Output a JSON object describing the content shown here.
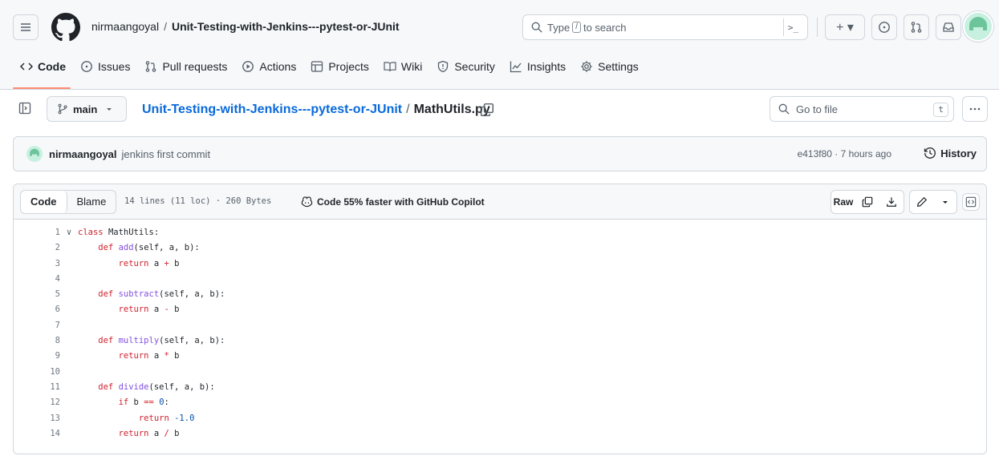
{
  "header": {
    "owner": "nirmaangoyal",
    "separator": "/",
    "repo": "Unit-Testing-with-Jenkins---pytest-or-JUnit",
    "search_prefix": "Type",
    "search_key": "/",
    "search_suffix": "to search",
    "terminal_label": ">_",
    "plus_label": "+ ▾"
  },
  "tabs": [
    {
      "label": "Code",
      "icon": "code-icon"
    },
    {
      "label": "Issues",
      "icon": "issue-icon"
    },
    {
      "label": "Pull requests",
      "icon": "pull-request-icon"
    },
    {
      "label": "Actions",
      "icon": "play-icon"
    },
    {
      "label": "Projects",
      "icon": "table-icon"
    },
    {
      "label": "Wiki",
      "icon": "book-icon"
    },
    {
      "label": "Security",
      "icon": "shield-icon"
    },
    {
      "label": "Insights",
      "icon": "graph-icon"
    },
    {
      "label": "Settings",
      "icon": "gear-icon"
    }
  ],
  "breadcrumb": {
    "branch": "main",
    "repo": "Unit-Testing-with-Jenkins---pytest-or-JUnit",
    "sep": "/",
    "file": "MathUtils.py",
    "goto_placeholder": "Go to file",
    "goto_key": "t"
  },
  "commit": {
    "user": "nirmaangoyal",
    "message": "jenkins first commit",
    "meta": "e413f80 · 7 hours ago",
    "history_label": "History"
  },
  "file": {
    "code_tab": "Code",
    "blame_tab": "Blame",
    "info": "14 lines (11 loc) · 260 Bytes",
    "copilot": "Code 55% faster with GitHub Copilot",
    "raw_label": "Raw"
  },
  "colors": {
    "accent": "#fd8c73",
    "link": "#0969da",
    "keyword": "#cf222e",
    "function": "#8250df",
    "number": "#0550ae"
  },
  "code_lines": [
    {
      "n": "1",
      "fold": true,
      "segs": [
        {
          "t": "class ",
          "c": "kw"
        },
        {
          "t": "MathUtils:",
          "c": ""
        }
      ]
    },
    {
      "n": "2",
      "segs": [
        {
          "t": "    def ",
          "c": "kw"
        },
        {
          "t": "add",
          "c": "fn"
        },
        {
          "t": "(self, a, b):",
          "c": ""
        }
      ]
    },
    {
      "n": "3",
      "segs": [
        {
          "t": "        return ",
          "c": "kw"
        },
        {
          "t": "a ",
          "c": ""
        },
        {
          "t": "+",
          "c": "kw"
        },
        {
          "t": " b",
          "c": ""
        }
      ]
    },
    {
      "n": "4",
      "segs": []
    },
    {
      "n": "5",
      "segs": [
        {
          "t": "    def ",
          "c": "kw"
        },
        {
          "t": "subtract",
          "c": "fn"
        },
        {
          "t": "(self, a, b):",
          "c": ""
        }
      ]
    },
    {
      "n": "6",
      "segs": [
        {
          "t": "        return ",
          "c": "kw"
        },
        {
          "t": "a ",
          "c": ""
        },
        {
          "t": "-",
          "c": "kw"
        },
        {
          "t": " b",
          "c": ""
        }
      ]
    },
    {
      "n": "7",
      "segs": []
    },
    {
      "n": "8",
      "segs": [
        {
          "t": "    def ",
          "c": "kw"
        },
        {
          "t": "multiply",
          "c": "fn"
        },
        {
          "t": "(self, a, b):",
          "c": ""
        }
      ]
    },
    {
      "n": "9",
      "segs": [
        {
          "t": "        return ",
          "c": "kw"
        },
        {
          "t": "a ",
          "c": ""
        },
        {
          "t": "*",
          "c": "kw"
        },
        {
          "t": " b",
          "c": ""
        }
      ]
    },
    {
      "n": "10",
      "segs": []
    },
    {
      "n": "11",
      "segs": [
        {
          "t": "    def ",
          "c": "kw"
        },
        {
          "t": "divide",
          "c": "fn"
        },
        {
          "t": "(self, a, b):",
          "c": ""
        }
      ]
    },
    {
      "n": "12",
      "segs": [
        {
          "t": "        if ",
          "c": "kw"
        },
        {
          "t": "b ",
          "c": ""
        },
        {
          "t": "==",
          "c": "kw"
        },
        {
          "t": " ",
          "c": ""
        },
        {
          "t": "0",
          "c": "nm"
        },
        {
          "t": ":",
          "c": ""
        }
      ]
    },
    {
      "n": "13",
      "segs": [
        {
          "t": "            return ",
          "c": "kw"
        },
        {
          "t": "-1.0",
          "c": "nm"
        }
      ]
    },
    {
      "n": "14",
      "segs": [
        {
          "t": "        return ",
          "c": "kw"
        },
        {
          "t": "a ",
          "c": ""
        },
        {
          "t": "/",
          "c": "kw"
        },
        {
          "t": " b",
          "c": ""
        }
      ]
    }
  ]
}
